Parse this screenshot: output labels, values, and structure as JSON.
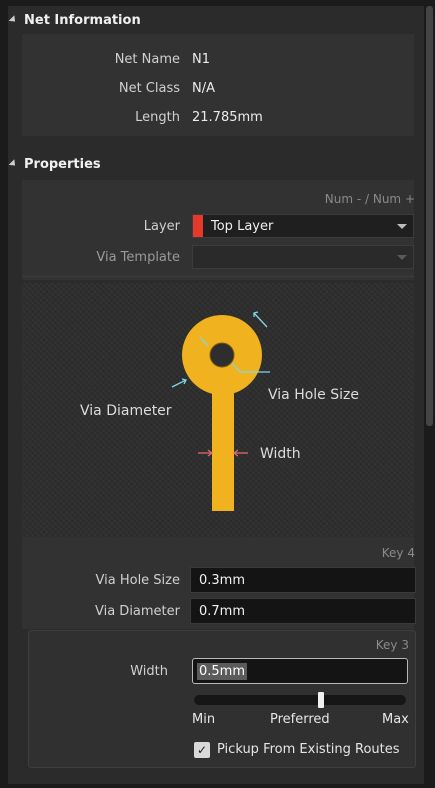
{
  "net_information": {
    "header": "Net Information",
    "rows": [
      {
        "label": "Net Name",
        "value": "N1"
      },
      {
        "label": "Net Class",
        "value": "N/A"
      },
      {
        "label": "Length",
        "value": "21.785mm"
      }
    ]
  },
  "properties": {
    "header": "Properties",
    "num_hint": "Num - / Num +",
    "layer_label": "Layer",
    "layer_value": "Top Layer",
    "layer_color": "#e53a2b",
    "via_template_label": "Via Template",
    "via_template_value": "",
    "diagram": {
      "via_diameter": "Via Diameter",
      "via_hole_size": "Via Hole Size",
      "width": "Width",
      "via_color": "#f0b21e",
      "arrow_color": "#7fd8e8"
    },
    "key4_hint": "Key 4",
    "via_hole_size_label": "Via Hole Size",
    "via_hole_size_value": "0.3mm",
    "via_diameter_label": "Via Diameter",
    "via_diameter_value": "0.7mm",
    "key3_hint": "Key 3",
    "width_label": "Width",
    "width_value": "0.5mm",
    "slider_level": 0.6,
    "slider_min": "Min",
    "slider_preferred": "Preferred",
    "slider_max": "Max",
    "pickup_checked": true,
    "pickup_label": "Pickup From Existing Routes"
  }
}
